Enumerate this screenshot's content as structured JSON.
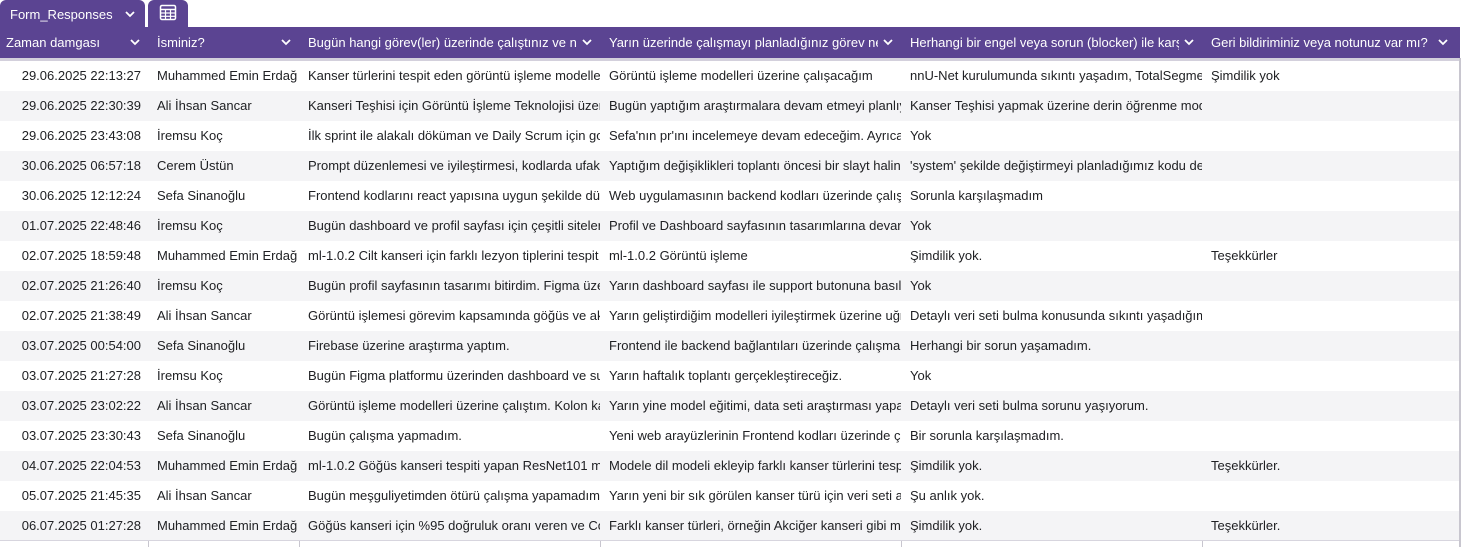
{
  "tabs": {
    "sheet_label": "Form_Responses",
    "grid_icon": "table-grid-icon",
    "chevron_icon": "chevron-down-icon"
  },
  "colors": {
    "header_bg": "#5b4492",
    "header_text": "#ffffff",
    "alt_row_bg": "#f4f4f6"
  },
  "columns": [
    "Zaman damgası",
    "İsminiz?",
    "Bugün hangi görev(ler) üzerinde çalıştınız ve ne",
    "Yarın üzerinde çalışmayı planladığınız görev nec",
    "Herhangi bir engel veya sorun (blocker) ile karşı",
    "Geri bildiriminiz veya notunuz var mı?"
  ],
  "rows": [
    [
      "29.06.2025 22:13:27",
      "Muhammed Emin Erdağ",
      "Kanser türlerini tespit eden görüntü işleme modelleri",
      "Görüntü işleme modelleri üzerine çalışacağım",
      "nnU-Net kurulumunda sıkıntı yaşadım, TotalSegmen",
      "Şimdilik yok"
    ],
    [
      "29.06.2025 22:30:39",
      "Ali İhsan Sancar",
      "Kanseri Teşhisi için Görüntü İşleme Teknolojisi üzer",
      "Bugün yaptığım araştırmalara devam etmeyi planlıyc",
      "Kanser Teşhisi yapmak üzerine derin öğrenme mode",
      ""
    ],
    [
      "29.06.2025 23:43:08",
      "İremsu Koç",
      "İlk sprint ile alakalı döküman ve Daily Scrum için goo",
      "Sefa'nın pr'ını incelemeye devam edeceğim. Ayrıca v",
      "Yok",
      ""
    ],
    [
      "30.06.2025 06:57:18",
      "Cerem Üstün",
      "Prompt düzenlemesi ve iyileştirmesi, kodlarda ufak d",
      "Yaptığım değişiklikleri toplantı öncesi bir slayt haline",
      "'system' şekilde değiştirmeyi planladığımız kodu değ",
      ""
    ],
    [
      "30.06.2025 12:12:24",
      "Sefa Sinanoğlu",
      "Frontend kodlarını react yapısına uygun şekilde düze",
      "Web uygulamasının backend kodları üzerinde çalışa",
      "Sorunla karşılaşmadım",
      ""
    ],
    [
      "01.07.2025 22:48:46",
      "İremsu Koç",
      "Bugün dashboard ve profil sayfası için çeşitli sitelerd",
      "Profil ve Dashboard sayfasının tasarımlarına devam",
      "Yok",
      ""
    ],
    [
      "02.07.2025 18:59:48",
      "Muhammed Emin Erdağ",
      "ml-1.0.2 Cilt kanseri için farklı lezyon tiplerini tespit e",
      "ml-1.0.2 Görüntü işleme",
      "Şimdilik yok.",
      "Teşekkürler"
    ],
    [
      "02.07.2025 21:26:40",
      "İremsu Koç",
      "Bugün profil sayfasının tasarımı bitirdim. Figma üzer",
      "Yarın dashboard sayfası ile support butonuna basıld",
      "Yok",
      ""
    ],
    [
      "02.07.2025 21:38:49",
      "Ali İhsan Sancar",
      "Görüntü işlemesi görevim kapsamında göğüs ve akc",
      "Yarın geliştirdiğim modelleri iyileştirmek üzerine uğra",
      "Detaylı veri seti bulma konusunda sıkıntı yaşadığım",
      ""
    ],
    [
      "03.07.2025 00:54:00",
      "Sefa Sinanoğlu",
      "Firebase üzerine araştırma yaptım.",
      "Frontend ile backend bağlantıları üzerinde çalışma y",
      "Herhangi bir sorun yaşamadım.",
      ""
    ],
    [
      "03.07.2025 21:27:28",
      "İremsu Koç",
      "Bugün Figma platformu üzerinden dashboard ve sup",
      "Yarın haftalık toplantı gerçekleştireceğiz.",
      "Yok",
      ""
    ],
    [
      "03.07.2025 23:02:22",
      "Ali İhsan Sancar",
      "Görüntü işleme modelleri üzerine çalıştım. Kolon kan",
      "Yarın yine model eğitimi, data seti araştırması yapac",
      "Detaylı veri seti bulma sorunu yaşıyorum.",
      ""
    ],
    [
      "03.07.2025 23:30:43",
      "Sefa Sinanoğlu",
      "Bugün çalışma yapmadım.",
      "Yeni web arayüzlerinin Frontend kodları üzerinde çal",
      "Bir sorunla karşılaşmadım.",
      ""
    ],
    [
      "04.07.2025 22:04:53",
      "Muhammed Emin Erdağ",
      "ml-1.0.2 Göğüs kanseri tespiti yapan ResNet101 mir",
      "Modele dil modeli ekleyip farklı kanser türlerini tespi",
      "Şimdilik yok.",
      "Teşekkürler."
    ],
    [
      "05.07.2025 21:45:35",
      "Ali İhsan Sancar",
      "Bugün meşguliyetimden ötürü çalışma yapamadım.",
      "Yarın yeni bir sık görülen kanser türü için veri seti ara",
      "Şu anlık yok.",
      ""
    ],
    [
      "06.07.2025 01:27:28",
      "Muhammed Emin Erdağ",
      "Göğüs kanseri için %95 doğruluk oranı veren ve Cont",
      "Farklı kanser türleri, örneğin Akciğer kanseri gibi mo",
      "Şimdilik yok.",
      "Teşekkürler."
    ]
  ]
}
